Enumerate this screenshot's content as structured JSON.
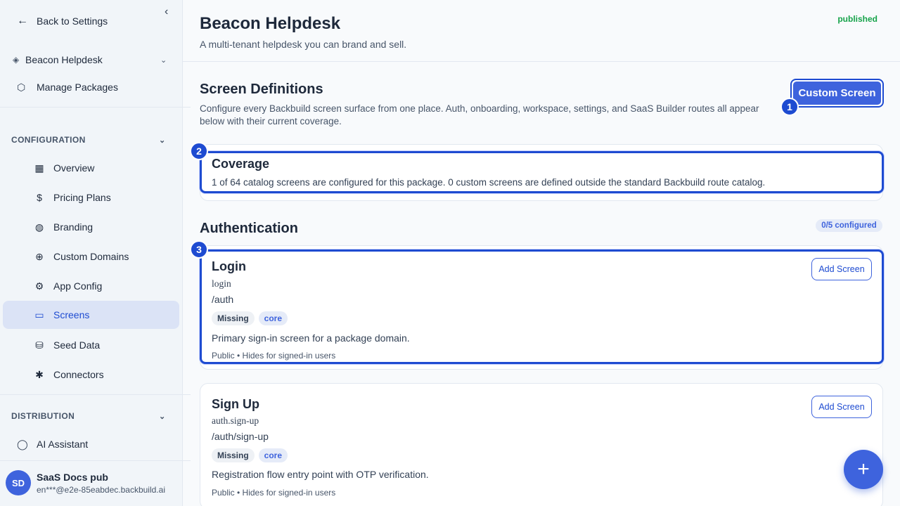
{
  "sidebar": {
    "back_label": "Back to Settings",
    "package_name": "Beacon Helpdesk",
    "manage_packages": "Manage Packages",
    "configuration_label": "CONFIGURATION",
    "items": [
      {
        "label": "Overview",
        "icon": "grid-icon"
      },
      {
        "label": "Pricing Plans",
        "icon": "dollar-icon"
      },
      {
        "label": "Branding",
        "icon": "palette-icon"
      },
      {
        "label": "Custom Domains",
        "icon": "globe-icon"
      },
      {
        "label": "App Config",
        "icon": "gear-icon"
      },
      {
        "label": "Screens",
        "icon": "devices-icon"
      },
      {
        "label": "Seed Data",
        "icon": "database-icon"
      },
      {
        "label": "Connectors",
        "icon": "plug-icon"
      }
    ],
    "distribution_label": "DISTRIBUTION",
    "ai_assistant": "AI Assistant",
    "user": {
      "initials": "SD",
      "name": "SaaS Docs pub",
      "email": "en***@e2e-85eabdec.backbuild.ai"
    }
  },
  "header": {
    "title": "Beacon Helpdesk",
    "subtitle": "A multi-tenant helpdesk you can brand and sell.",
    "status": "published"
  },
  "screen_definitions": {
    "title": "Screen Definitions",
    "description": "Configure every Backbuild screen surface from one place. Auth, onboarding, workspace, settings, and SaaS Builder routes all appear below with their current coverage.",
    "custom_screen_label": "Custom Screen"
  },
  "coverage": {
    "title": "Coverage",
    "text": "1 of 64 catalog screens are configured for this package. 0 custom screens are defined outside the standard Backbuild route catalog."
  },
  "authentication": {
    "title": "Authentication",
    "configured_badge": "0/5 configured",
    "screens": [
      {
        "title": "Login",
        "key": "login",
        "route": "/auth",
        "status": "Missing",
        "tier": "core",
        "description": "Primary sign-in screen for a package domain.",
        "meta": "Public • Hides for signed-in users",
        "add_label": "Add Screen"
      },
      {
        "title": "Sign Up",
        "key": "auth.sign-up",
        "route": "/auth/sign-up",
        "status": "Missing",
        "tier": "core",
        "description": "Registration flow entry point with OTP verification.",
        "meta": "Public • Hides for signed-in users",
        "add_label": "Add Screen"
      }
    ]
  },
  "markers": [
    "1",
    "2",
    "3"
  ],
  "fab_label": "+",
  "colors": {
    "accent": "#3e63dd",
    "accent_dark": "#1e4bd1",
    "published": "#16a34a",
    "active_bg": "#dbe3f6"
  }
}
